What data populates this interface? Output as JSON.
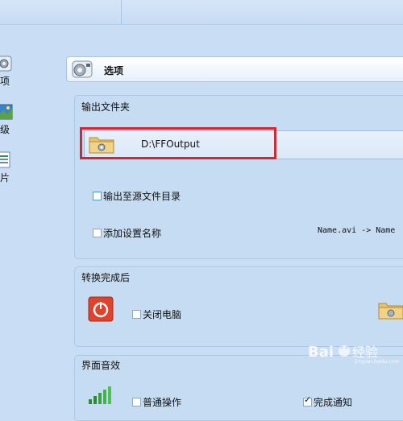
{
  "nav": {
    "items": [
      {
        "label": "项",
        "icon": "options-icon"
      },
      {
        "label": "级",
        "icon": "advanced-icon"
      },
      {
        "label": "片",
        "icon": "picture-icon"
      }
    ]
  },
  "panel": {
    "title": "选项",
    "icon": "options-icon"
  },
  "output_folder": {
    "section_title": "输出文件夹",
    "path": "D:\\FFOutput",
    "output_to_source_label": "输出至源文件目录",
    "output_to_source_checked": false,
    "add_setting_name_label": "添加设置名称",
    "add_setting_name_checked": false,
    "name_example": "Name.avi  -> Name"
  },
  "after_conversion": {
    "section_title": "转换完成后",
    "shutdown_label": "关闭电脑",
    "shutdown_checked": false
  },
  "ui_sound": {
    "section_title": "界面音效",
    "normal_op_label": "普通操作",
    "normal_op_checked": false,
    "complete_notify_label": "完成通知",
    "complete_notify_checked": true
  },
  "watermark": {
    "brand": "Bai",
    "brand2": "经验",
    "sub": "jingyan.baidu.com"
  },
  "colors": {
    "highlight": "#d7262e",
    "power": "#e0432c",
    "accent": "#3f9fd8"
  }
}
